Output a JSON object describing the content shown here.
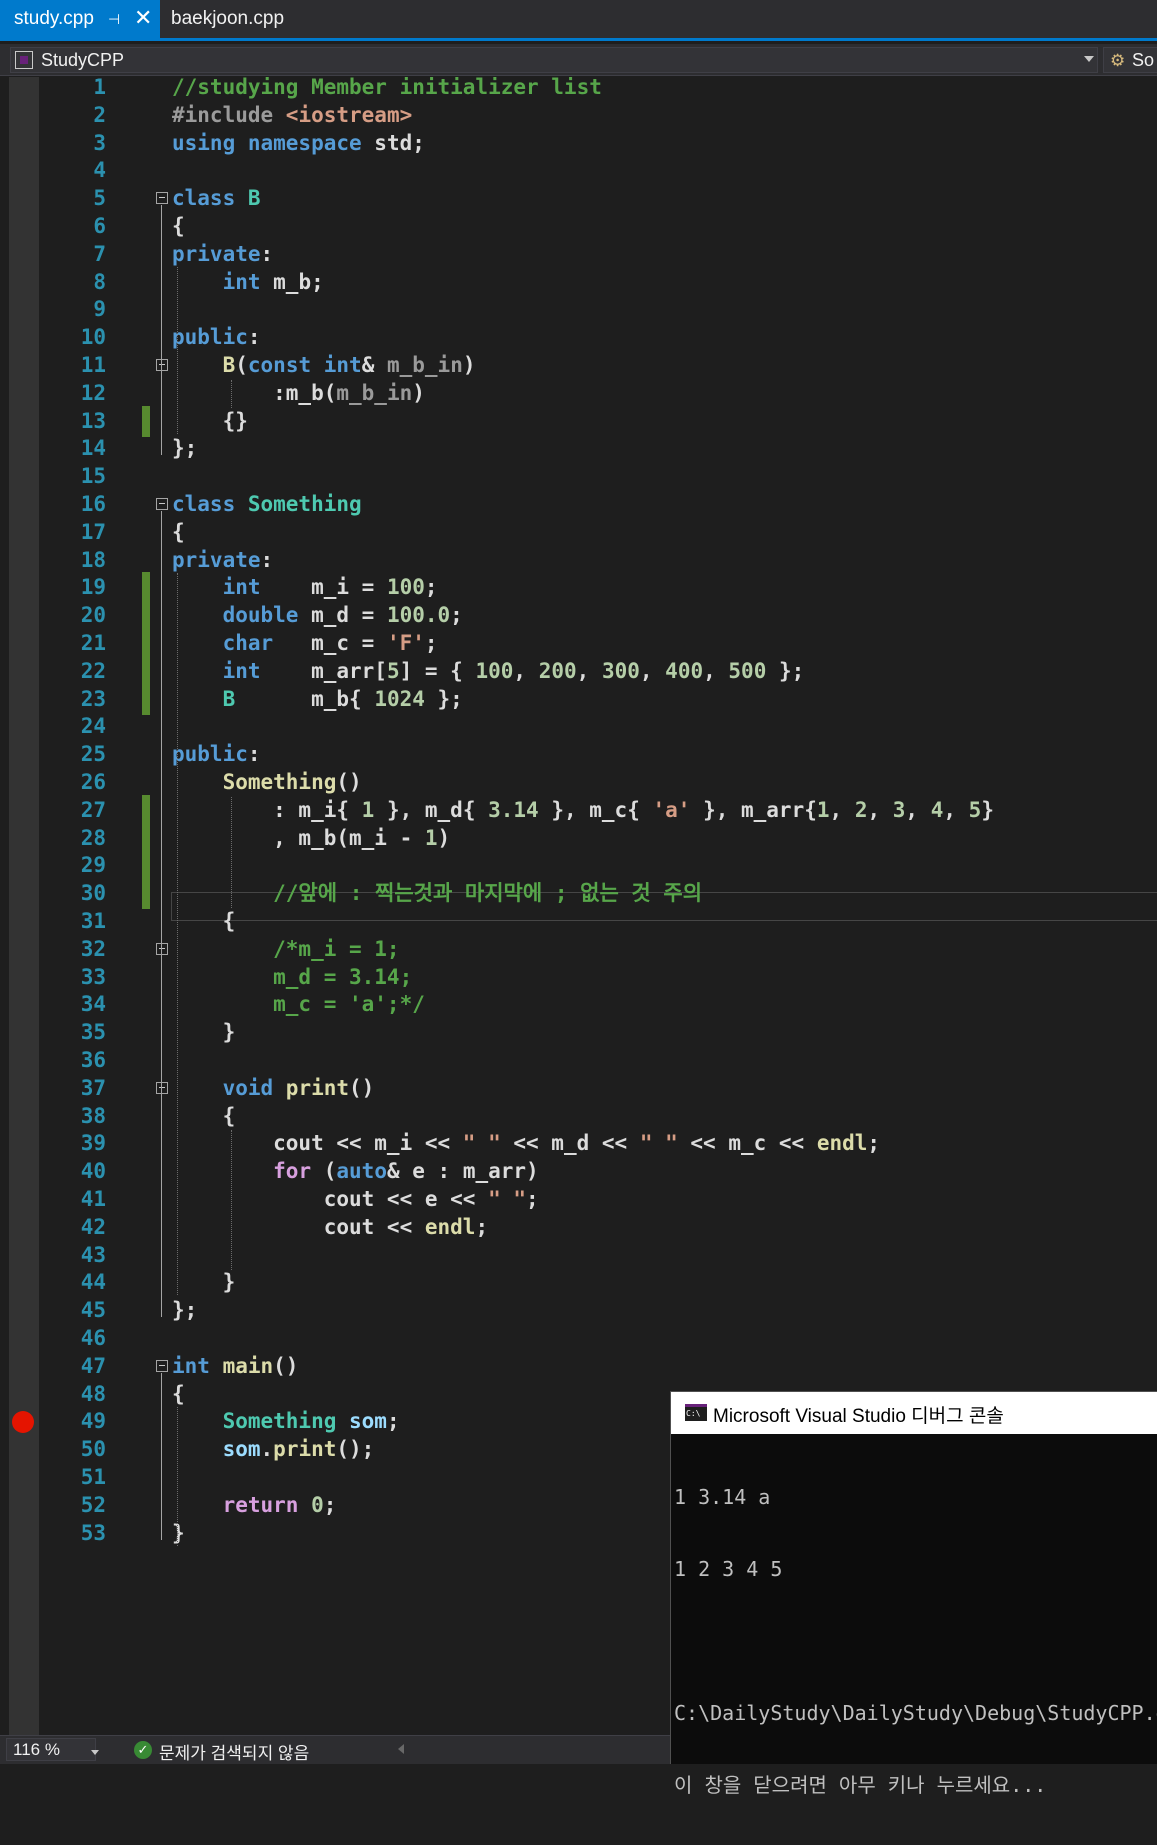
{
  "tabs": [
    {
      "label": "study.cpp",
      "active": true,
      "pinned": true
    },
    {
      "label": "baekjoon.cpp",
      "active": false
    }
  ],
  "navbar": {
    "project": "StudyCPP",
    "member_scope": "So"
  },
  "editor": {
    "lines": [
      {
        "n": "1",
        "tokens": [
          [
            "cm",
            "//studying Member initializer list"
          ]
        ]
      },
      {
        "n": "2",
        "tokens": [
          [
            "pp",
            "#include "
          ],
          [
            "st",
            "<iostream>"
          ]
        ]
      },
      {
        "n": "3",
        "tokens": [
          [
            "kw",
            "using namespace "
          ],
          [
            "df",
            "std;"
          ]
        ]
      },
      {
        "n": "4",
        "tokens": []
      },
      {
        "n": "5",
        "tokens": [
          [
            "kw",
            "class "
          ],
          [
            "ty",
            "B"
          ]
        ]
      },
      {
        "n": "6",
        "tokens": [
          [
            "df",
            "{"
          ]
        ]
      },
      {
        "n": "7",
        "tokens": [
          [
            "kw",
            "private"
          ],
          [
            "df",
            ":"
          ]
        ]
      },
      {
        "n": "8",
        "tokens": [
          [
            "df",
            "    "
          ],
          [
            "kw",
            "int "
          ],
          [
            "df",
            "m_b;"
          ]
        ]
      },
      {
        "n": "9",
        "tokens": []
      },
      {
        "n": "10",
        "tokens": [
          [
            "kw",
            "public"
          ],
          [
            "df",
            ":"
          ]
        ]
      },
      {
        "n": "11",
        "tokens": [
          [
            "df",
            "    "
          ],
          [
            "fn",
            "B"
          ],
          [
            "df",
            "("
          ],
          [
            "kw",
            "const int"
          ],
          [
            "df",
            "& "
          ],
          [
            "pr",
            "m_b_in"
          ],
          [
            "df",
            ")"
          ]
        ]
      },
      {
        "n": "12",
        "tokens": [
          [
            "df",
            "        :m_b("
          ],
          [
            "pr",
            "m_b_in"
          ],
          [
            "df",
            ")"
          ]
        ]
      },
      {
        "n": "13",
        "tokens": [
          [
            "df",
            "    {}"
          ]
        ]
      },
      {
        "n": "14",
        "tokens": [
          [
            "df",
            "};"
          ]
        ]
      },
      {
        "n": "15",
        "tokens": []
      },
      {
        "n": "16",
        "tokens": [
          [
            "kw",
            "class "
          ],
          [
            "ty",
            "Something"
          ]
        ]
      },
      {
        "n": "17",
        "tokens": [
          [
            "df",
            "{"
          ]
        ]
      },
      {
        "n": "18",
        "tokens": [
          [
            "kw",
            "private"
          ],
          [
            "df",
            ":"
          ]
        ]
      },
      {
        "n": "19",
        "tokens": [
          [
            "df",
            "    "
          ],
          [
            "kw",
            "int    "
          ],
          [
            "df",
            "m_i = "
          ],
          [
            "nm",
            "100"
          ],
          [
            "df",
            ";"
          ]
        ]
      },
      {
        "n": "20",
        "tokens": [
          [
            "df",
            "    "
          ],
          [
            "kw",
            "double "
          ],
          [
            "df",
            "m_d = "
          ],
          [
            "nm",
            "100.0"
          ],
          [
            "df",
            ";"
          ]
        ]
      },
      {
        "n": "21",
        "tokens": [
          [
            "df",
            "    "
          ],
          [
            "kw",
            "char   "
          ],
          [
            "df",
            "m_c = "
          ],
          [
            "st",
            "'F'"
          ],
          [
            "df",
            ";"
          ]
        ]
      },
      {
        "n": "22",
        "tokens": [
          [
            "df",
            "    "
          ],
          [
            "kw",
            "int    "
          ],
          [
            "df",
            "m_arr["
          ],
          [
            "nm",
            "5"
          ],
          [
            "df",
            "] = { "
          ],
          [
            "nm",
            "100"
          ],
          [
            "df",
            ", "
          ],
          [
            "nm",
            "200"
          ],
          [
            "df",
            ", "
          ],
          [
            "nm",
            "300"
          ],
          [
            "df",
            ", "
          ],
          [
            "nm",
            "400"
          ],
          [
            "df",
            ", "
          ],
          [
            "nm",
            "500"
          ],
          [
            "df",
            " };"
          ]
        ]
      },
      {
        "n": "23",
        "tokens": [
          [
            "df",
            "    "
          ],
          [
            "ty",
            "B      "
          ],
          [
            "df",
            "m_b{ "
          ],
          [
            "nm",
            "1024"
          ],
          [
            "df",
            " };"
          ]
        ]
      },
      {
        "n": "24",
        "tokens": []
      },
      {
        "n": "25",
        "tokens": [
          [
            "kw",
            "public"
          ],
          [
            "df",
            ":"
          ]
        ]
      },
      {
        "n": "26",
        "tokens": [
          [
            "df",
            "    "
          ],
          [
            "fn",
            "Something"
          ],
          [
            "df",
            "()"
          ]
        ]
      },
      {
        "n": "27",
        "tokens": [
          [
            "df",
            "        : m_i{ "
          ],
          [
            "nm",
            "1"
          ],
          [
            "df",
            " }, m_d{ "
          ],
          [
            "nm",
            "3.14"
          ],
          [
            "df",
            " }, m_c{ "
          ],
          [
            "st",
            "'a'"
          ],
          [
            "df",
            " }, m_arr{"
          ],
          [
            "nm",
            "1"
          ],
          [
            "df",
            ", "
          ],
          [
            "nm",
            "2"
          ],
          [
            "df",
            ", "
          ],
          [
            "nm",
            "3"
          ],
          [
            "df",
            ", "
          ],
          [
            "nm",
            "4"
          ],
          [
            "df",
            ", "
          ],
          [
            "nm",
            "5"
          ],
          [
            "df",
            "}"
          ]
        ]
      },
      {
        "n": "28",
        "tokens": [
          [
            "df",
            "        , m_b(m_i - "
          ],
          [
            "nm",
            "1"
          ],
          [
            "df",
            ")"
          ]
        ]
      },
      {
        "n": "29",
        "tokens": []
      },
      {
        "n": "30",
        "tokens": [
          [
            "cm",
            "        //앞에 : 찍는것과 마지막에 ; 없는 것 주의"
          ]
        ]
      },
      {
        "n": "31",
        "tokens": [
          [
            "df",
            "    {"
          ]
        ]
      },
      {
        "n": "32",
        "tokens": [
          [
            "cm",
            "        /*m_i = 1;"
          ]
        ]
      },
      {
        "n": "33",
        "tokens": [
          [
            "cm",
            "        m_d = 3.14;"
          ]
        ]
      },
      {
        "n": "34",
        "tokens": [
          [
            "cm",
            "        m_c = 'a';*/"
          ]
        ]
      },
      {
        "n": "35",
        "tokens": [
          [
            "df",
            "    }"
          ]
        ]
      },
      {
        "n": "36",
        "tokens": []
      },
      {
        "n": "37",
        "tokens": [
          [
            "df",
            "    "
          ],
          [
            "kw",
            "void "
          ],
          [
            "fn",
            "print"
          ],
          [
            "df",
            "()"
          ]
        ]
      },
      {
        "n": "38",
        "tokens": [
          [
            "df",
            "    {"
          ]
        ]
      },
      {
        "n": "39",
        "tokens": [
          [
            "df",
            "        cout << m_i << "
          ],
          [
            "st",
            "\" \""
          ],
          [
            "df",
            " << m_d << "
          ],
          [
            "st",
            "\" \""
          ],
          [
            "df",
            " << m_c << "
          ],
          [
            "fn",
            "endl"
          ],
          [
            "df",
            ";"
          ]
        ]
      },
      {
        "n": "40",
        "tokens": [
          [
            "df",
            "        "
          ],
          [
            "ctl",
            "for "
          ],
          [
            "df",
            "("
          ],
          [
            "kw",
            "auto"
          ],
          [
            "df",
            "& e : m_arr)"
          ]
        ]
      },
      {
        "n": "41",
        "tokens": [
          [
            "df",
            "            cout << e << "
          ],
          [
            "st",
            "\" \""
          ],
          [
            "df",
            ";"
          ]
        ]
      },
      {
        "n": "42",
        "tokens": [
          [
            "df",
            "            cout << "
          ],
          [
            "fn",
            "endl"
          ],
          [
            "df",
            ";"
          ]
        ]
      },
      {
        "n": "43",
        "tokens": []
      },
      {
        "n": "44",
        "tokens": [
          [
            "df",
            "    }"
          ]
        ]
      },
      {
        "n": "45",
        "tokens": [
          [
            "df",
            "};"
          ]
        ]
      },
      {
        "n": "46",
        "tokens": []
      },
      {
        "n": "47",
        "tokens": [
          [
            "kw",
            "int "
          ],
          [
            "fn",
            "main"
          ],
          [
            "df",
            "()"
          ]
        ]
      },
      {
        "n": "48",
        "tokens": [
          [
            "df",
            "{"
          ]
        ]
      },
      {
        "n": "49",
        "tokens": [
          [
            "df",
            "    "
          ],
          [
            "ty",
            "Something "
          ],
          [
            "va",
            "som"
          ],
          [
            "df",
            ";"
          ]
        ]
      },
      {
        "n": "50",
        "tokens": [
          [
            "df",
            "    "
          ],
          [
            "va",
            "som"
          ],
          [
            "df",
            "."
          ],
          [
            "fn",
            "print"
          ],
          [
            "df",
            "();"
          ]
        ]
      },
      {
        "n": "51",
        "tokens": []
      },
      {
        "n": "52",
        "tokens": [
          [
            "df",
            "    "
          ],
          [
            "ctl",
            "return "
          ],
          [
            "nm",
            "0"
          ],
          [
            "df",
            ";"
          ]
        ]
      },
      {
        "n": "53",
        "tokens": [
          [
            "df",
            "}"
          ]
        ]
      }
    ],
    "fold_lines": [
      "5",
      "11",
      "16",
      "32",
      "37",
      "47"
    ],
    "changed_lines": [
      "13",
      "19",
      "20",
      "21",
      "22",
      "23",
      "27",
      "28",
      "29",
      "30"
    ],
    "breakpoint_line": "49",
    "current_line": "27"
  },
  "statusbar": {
    "zoom": "116 %",
    "issues": "문제가 검색되지 않음"
  },
  "console": {
    "title": "Microsoft Visual Studio 디버그 콘솔",
    "icon_text": "C:\\",
    "output": [
      "1 3.14 a",
      "1 2 3 4 5",
      "",
      "C:\\DailyStudy\\DailyStudy\\Debug\\StudyCPP.exe",
      "이 창을 닫으려면 아무 키나 누르세요..."
    ]
  },
  "colors": {
    "accent": "#007acc",
    "keyword": "#569cd6",
    "type": "#4ec9b0",
    "comment": "#57a64a",
    "string": "#d69d85",
    "number": "#b5cea8",
    "function": "#dcdcaa",
    "line_number": "#2b91af",
    "breakpoint": "#e51400",
    "change_bar": "#578a2f"
  }
}
